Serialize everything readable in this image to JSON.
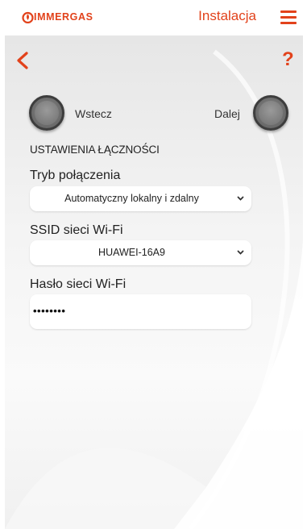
{
  "header": {
    "logo_text": "IMMERGAS",
    "section_title": "Instalacja",
    "menu_icon": "hamburger-menu-icon"
  },
  "toolbar": {
    "back_icon": "chevron-left-icon",
    "help_icon": "question-mark-icon",
    "help_symbol": "?"
  },
  "navigation": {
    "prev_label": "Wstecz",
    "next_label": "Dalej"
  },
  "form": {
    "heading": "USTAWIENIA ŁĄCZNOŚCI",
    "connection_mode": {
      "label": "Tryb połączenia",
      "value": "Automatyczny lokalny i zdalny"
    },
    "ssid": {
      "label": "SSID sieci Wi-Fi",
      "value": "HUAWEI-16A9"
    },
    "password": {
      "label": "Hasło sieci Wi-Fi",
      "value": "••••••••"
    }
  },
  "colors": {
    "accent": "#e2421b",
    "background": "#f2f2f2"
  }
}
